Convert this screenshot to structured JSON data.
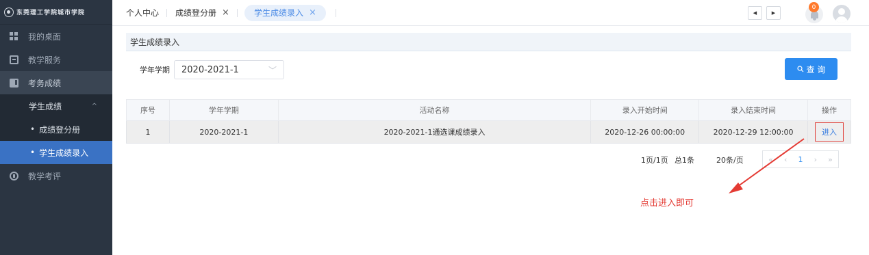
{
  "sidebar": {
    "logo_text": "东莞理工学院城市学院",
    "items": [
      {
        "label": "我的桌面",
        "icon": "desktop-icon"
      },
      {
        "label": "教学服务",
        "icon": "teaching-service-icon"
      },
      {
        "label": "考务成绩",
        "icon": "exam-grades-icon"
      },
      {
        "label": "教学考评",
        "icon": "teaching-evaluation-icon"
      }
    ],
    "submenu_head": "学生成绩",
    "submenu_head_arrow": "^",
    "submenu_items": [
      {
        "label": "成绩登分册"
      },
      {
        "label": "学生成绩录入"
      }
    ]
  },
  "tabs": [
    {
      "label": "个人中心"
    },
    {
      "label": "成绩登分册",
      "close": "×"
    },
    {
      "label": "学生成绩录入",
      "close": "×"
    }
  ],
  "header": {
    "nav_prev": "◀",
    "nav_next": "▶",
    "notification_count": "0"
  },
  "panel": {
    "title": "学生成绩录入",
    "filter_label": "学年学期",
    "term_value": "2020-2021-1",
    "query_label": "查 询"
  },
  "table": {
    "headers": [
      "序号",
      "学年学期",
      "活动名称",
      "录入开始时间",
      "录入结束时间",
      "操作"
    ],
    "rows": [
      {
        "no": "1",
        "term": "2020-2021-1",
        "activity": "2020-2021-1通选课成绩录入",
        "start": "2020-12-26 00:00:00",
        "end": "2020-12-29 12:00:00",
        "action": "进入"
      }
    ]
  },
  "pagination": {
    "pages": "1页/1页",
    "total": "总1条",
    "per_page": "20条/页",
    "first": "«",
    "prev": "‹",
    "current": "1",
    "next": "›",
    "last": "»"
  },
  "annotation": {
    "hint": "点击进入即可",
    "color": "#e43a33"
  }
}
